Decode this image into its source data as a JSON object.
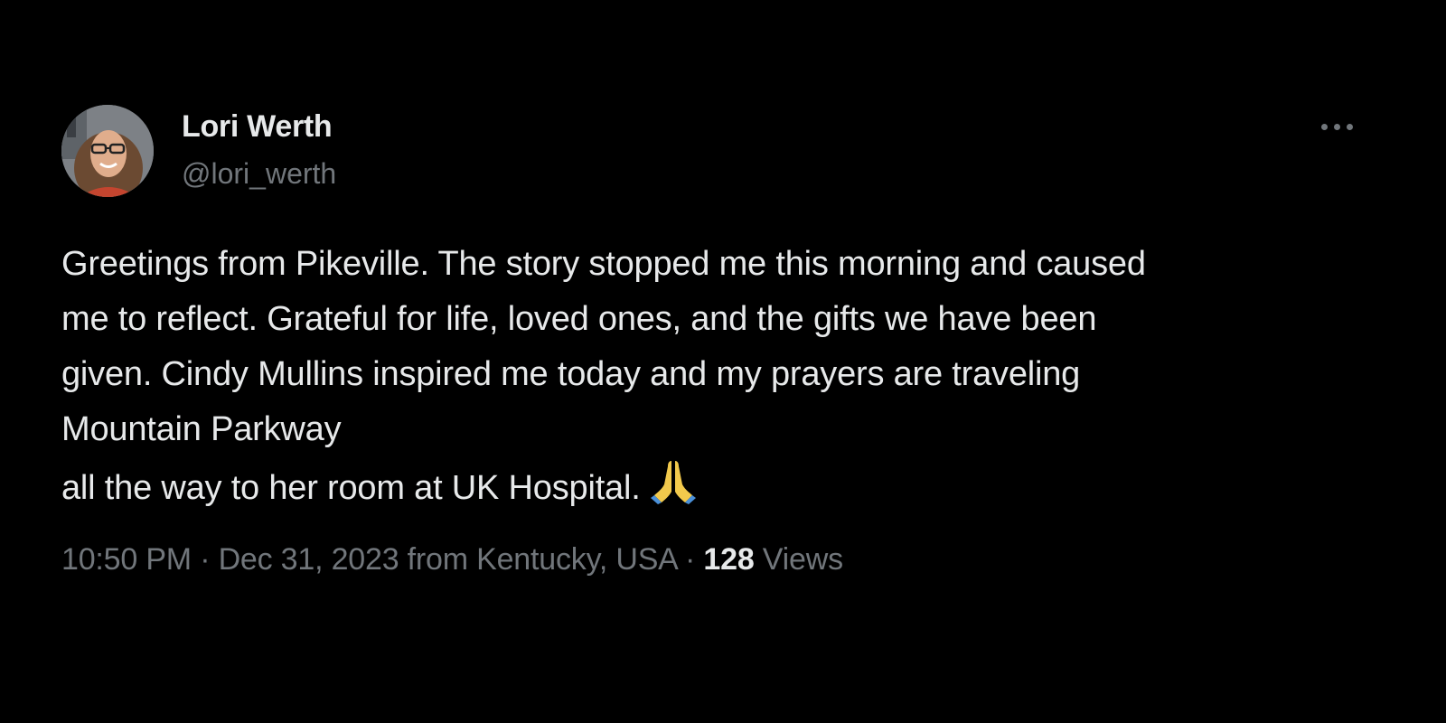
{
  "author": {
    "display_name": "Lori Werth",
    "handle": "@lori_werth"
  },
  "more_icon": "more-horizontal-icon",
  "tweet": {
    "lines": [
      "Greetings from Pikeville. The story stopped me this morning and caused",
      "me to reflect. Grateful for life, loved ones, and the gifts we have been",
      "given. Cindy Mullins inspired me today and my prayers are traveling",
      "Mountain Parkway",
      "all the way to her room at UK Hospital."
    ],
    "emoji": "folded-hands-emoji"
  },
  "meta": {
    "time": "10:50 PM",
    "date": "Dec 31, 2023",
    "location": "from Kentucky, USA",
    "separator": "·",
    "views_count": "128",
    "views_label": "Views"
  },
  "colors": {
    "background": "#000000",
    "primary_text": "#e7e9ea",
    "secondary_text": "#71767b",
    "emoji_color": "#f2c94c"
  }
}
